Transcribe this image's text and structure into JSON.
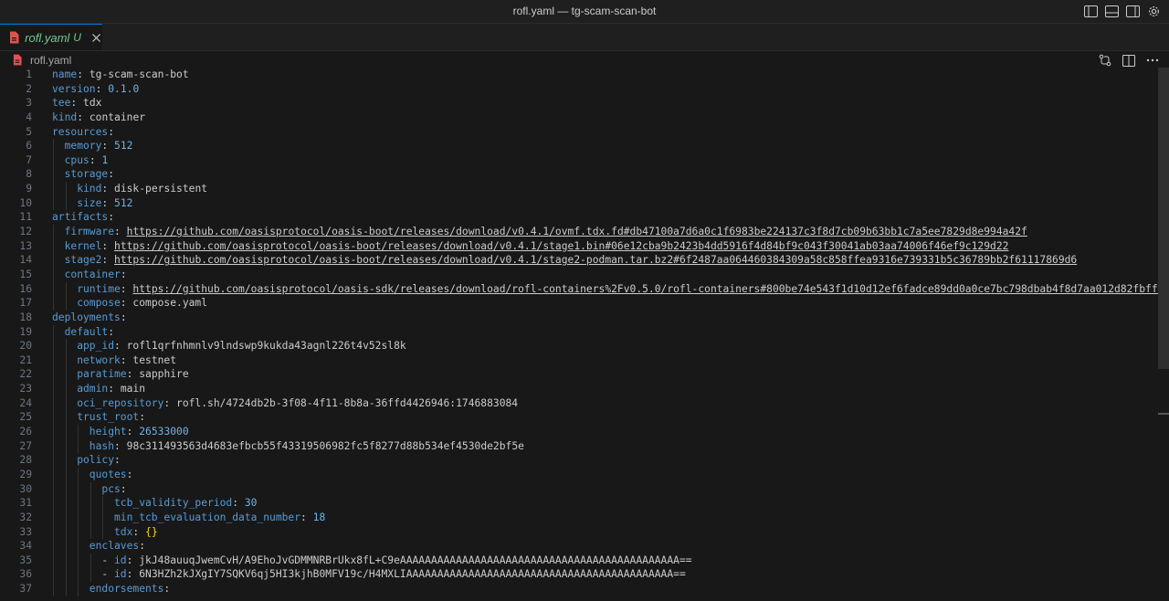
{
  "window": {
    "title": "rofl.yaml — tg-scam-scan-bot"
  },
  "tab": {
    "label": "rofl.yaml",
    "status": "U"
  },
  "breadcrumb": {
    "label": "rofl.yaml"
  },
  "icons": {
    "title_actions": [
      "toggle-primary-sidebar-icon",
      "toggle-panel-icon",
      "toggle-secondary-sidebar-icon",
      "gear-icon"
    ],
    "editor_actions": [
      "open-changes-icon",
      "split-editor-icon",
      "more-actions-icon"
    ],
    "file_icon": "yaml-file-icon"
  },
  "colors": {
    "key": "#569cd6",
    "number": "#6fb3e0",
    "modified": "#73c991",
    "accent": "#0078d4"
  },
  "lines": [
    {
      "n": "1",
      "indent": 0,
      "key": "name",
      "val": "tg-scam-scan-bot",
      "type": "s"
    },
    {
      "n": "2",
      "indent": 0,
      "key": "version",
      "val": "0.1.0",
      "type": "n"
    },
    {
      "n": "3",
      "indent": 0,
      "key": "tee",
      "val": "tdx",
      "type": "s"
    },
    {
      "n": "4",
      "indent": 0,
      "key": "kind",
      "val": "container",
      "type": "s"
    },
    {
      "n": "5",
      "indent": 0,
      "key": "resources",
      "val": "",
      "type": "s"
    },
    {
      "n": "6",
      "indent": 1,
      "key": "memory",
      "val": "512",
      "type": "n"
    },
    {
      "n": "7",
      "indent": 1,
      "key": "cpus",
      "val": "1",
      "type": "n"
    },
    {
      "n": "8",
      "indent": 1,
      "key": "storage",
      "val": "",
      "type": "s"
    },
    {
      "n": "9",
      "indent": 2,
      "key": "kind",
      "val": "disk-persistent",
      "type": "s"
    },
    {
      "n": "10",
      "indent": 2,
      "key": "size",
      "val": "512",
      "type": "n"
    },
    {
      "n": "11",
      "indent": 0,
      "key": "artifacts",
      "val": "",
      "type": "s"
    },
    {
      "n": "12",
      "indent": 1,
      "key": "firmware",
      "val": "https://github.com/oasisprotocol/oasis-boot/releases/download/v0.4.1/ovmf.tdx.fd#db47100a7d6a0c1f6983be224137c3f8d7cb09b63bb1c7a5ee7829d8e994a42f",
      "type": "u"
    },
    {
      "n": "13",
      "indent": 1,
      "key": "kernel",
      "val": "https://github.com/oasisprotocol/oasis-boot/releases/download/v0.4.1/stage1.bin#06e12cba9b2423b4dd5916f4d84bf9c043f30041ab03aa74006f46ef9c129d22",
      "type": "u"
    },
    {
      "n": "14",
      "indent": 1,
      "key": "stage2",
      "val": "https://github.com/oasisprotocol/oasis-boot/releases/download/v0.4.1/stage2-podman.tar.bz2#6f2487aa064460384309a58c858ffea9316e739331b5c36789bb2f61117869d6",
      "type": "u"
    },
    {
      "n": "15",
      "indent": 1,
      "key": "container",
      "val": "",
      "type": "s"
    },
    {
      "n": "16",
      "indent": 2,
      "key": "runtime",
      "val": "https://github.com/oasisprotocol/oasis-sdk/releases/download/rofl-containers%2Fv0.5.0/rofl-containers#800be74e543f1d10d12ef6fadce89dd0a0ce7bc798dbab4f8d7aa012d82fbff1",
      "type": "u"
    },
    {
      "n": "17",
      "indent": 2,
      "key": "compose",
      "val": "compose.yaml",
      "type": "s"
    },
    {
      "n": "18",
      "indent": 0,
      "key": "deployments",
      "val": "",
      "type": "s"
    },
    {
      "n": "19",
      "indent": 1,
      "key": "default",
      "val": "",
      "type": "s"
    },
    {
      "n": "20",
      "indent": 2,
      "key": "app_id",
      "val": "rofl1qrfnhmnlv9lndswp9kukda43agnl226t4v52sl8k",
      "type": "s"
    },
    {
      "n": "21",
      "indent": 2,
      "key": "network",
      "val": "testnet",
      "type": "s"
    },
    {
      "n": "22",
      "indent": 2,
      "key": "paratime",
      "val": "sapphire",
      "type": "s"
    },
    {
      "n": "23",
      "indent": 2,
      "key": "admin",
      "val": "main",
      "type": "s"
    },
    {
      "n": "24",
      "indent": 2,
      "key": "oci_repository",
      "val": "rofl.sh/4724db2b-3f08-4f11-8b8a-36ffd4426946:1746883084",
      "type": "s"
    },
    {
      "n": "25",
      "indent": 2,
      "key": "trust_root",
      "val": "",
      "type": "s"
    },
    {
      "n": "26",
      "indent": 3,
      "key": "height",
      "val": "26533000",
      "type": "n"
    },
    {
      "n": "27",
      "indent": 3,
      "key": "hash",
      "val": "98c311493563d4683efbcb55f43319506982fc5f8277d88b534ef4530de2bf5e",
      "type": "s"
    },
    {
      "n": "28",
      "indent": 2,
      "key": "policy",
      "val": "",
      "type": "s"
    },
    {
      "n": "29",
      "indent": 3,
      "key": "quotes",
      "val": "",
      "type": "s"
    },
    {
      "n": "30",
      "indent": 4,
      "key": "pcs",
      "val": "",
      "type": "s"
    },
    {
      "n": "31",
      "indent": 5,
      "key": "tcb_validity_period",
      "val": "30",
      "type": "n"
    },
    {
      "n": "32",
      "indent": 5,
      "key": "min_tcb_evaluation_data_number",
      "val": "18",
      "type": "n"
    },
    {
      "n": "33",
      "indent": 5,
      "key": "tdx",
      "val": "{}",
      "type": "br"
    },
    {
      "n": "34",
      "indent": 3,
      "key": "enclaves",
      "val": "",
      "type": "s"
    },
    {
      "n": "35",
      "indent": 4,
      "dash": true,
      "key": "id",
      "val": "jkJ48auuqJwemCvH/A9EhoJvGDMMNRBrUkx8fL+C9eAAAAAAAAAAAAAAAAAAAAAAAAAAAAAAAAAAAAAAAAAAAAA==",
      "type": "s"
    },
    {
      "n": "36",
      "indent": 4,
      "dash": true,
      "key": "id",
      "val": "6N3HZh2kJXgIY7SQKV6qj5HI3kjhB0MFV19c/H4MXLIAAAAAAAAAAAAAAAAAAAAAAAAAAAAAAAAAAAAAAAAAAA==",
      "type": "s"
    },
    {
      "n": "37",
      "indent": 3,
      "key": "endorsements",
      "val": "",
      "type": "s"
    }
  ]
}
